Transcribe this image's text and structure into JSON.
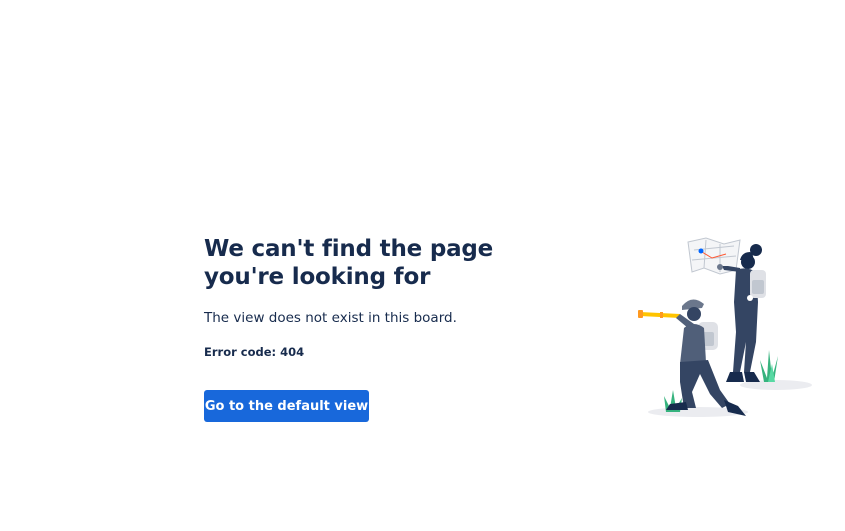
{
  "error": {
    "title": "We can't find the page you're looking for",
    "description": "The view does not exist in this board.",
    "code_label": "Error code: 404"
  },
  "actions": {
    "default_view_label": "Go to the default view"
  },
  "colors": {
    "primary": "#1868db",
    "text": "#172b4d"
  },
  "illustration": {
    "icon": "explorers-with-map-and-spyglass"
  }
}
